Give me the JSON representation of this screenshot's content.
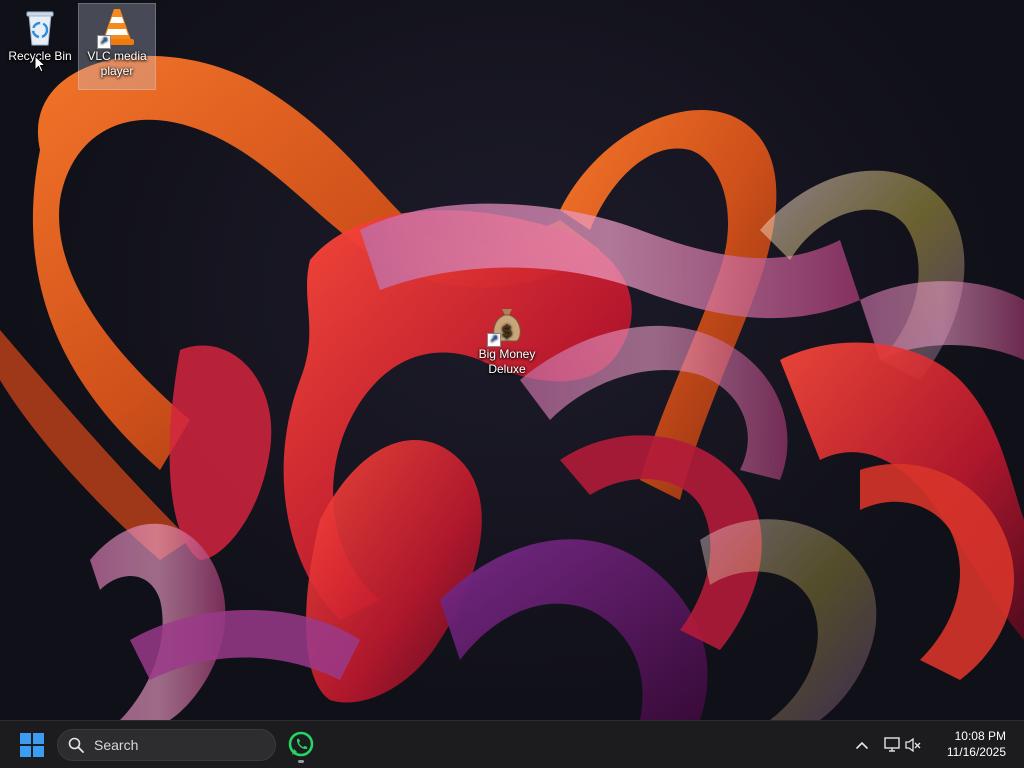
{
  "desktop": {
    "icons": [
      {
        "label": "Recycle Bin",
        "icon": "recycle-bin-icon"
      },
      {
        "label": "VLC media player",
        "icon": "vlc-cone-icon",
        "shortcut": true,
        "selected": true
      },
      {
        "label": "Big Money Deluxe",
        "icon": "money-bag-icon",
        "shortcut": true
      }
    ],
    "wallpaper": "windows-11-ribbon-bloom-dark",
    "accent_colors": [
      "#e8611a",
      "#c8203a",
      "#b04a8e",
      "#ff8a3c"
    ]
  },
  "taskbar": {
    "start": {
      "icon": "windows-logo-icon"
    },
    "search": {
      "label": "Search",
      "icon": "search-icon"
    },
    "pinned": [
      {
        "name": "WhatsApp",
        "icon": "whatsapp-icon",
        "running": true
      }
    ],
    "tray": {
      "chevron": "chevron-up-icon",
      "icons": [
        "network-icon",
        "volume-muted-icon"
      ]
    },
    "clock": {
      "time": "10:08 PM",
      "date": "11/16/2025"
    }
  }
}
